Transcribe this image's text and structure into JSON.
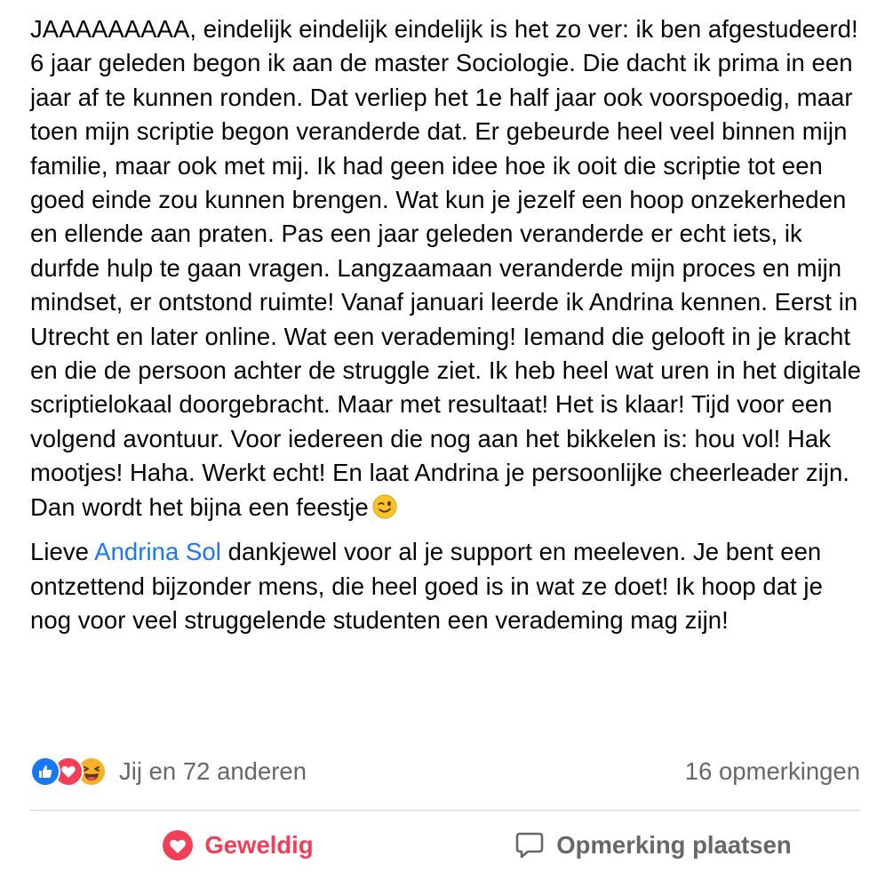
{
  "post": {
    "paragraph1": "JAAAAAAAAA, eindelijk eindelijk eindelijk is het zo ver: ik ben afgestudeerd! 6 jaar geleden begon ik aan de master Sociologie. Die dacht ik prima in een jaar af te kunnen ronden. Dat verliep het 1e half jaar ook voorspoedig, maar toen mijn scriptie begon veranderde dat. Er gebeurde heel veel binnen mijn familie, maar ook met mij. Ik had geen idee hoe ik ooit die scriptie tot een goed einde zou kunnen brengen. Wat kun je jezelf een hoop onzekerheden en ellende aan praten. Pas een jaar geleden veranderde er echt iets, ik durfde hulp te gaan vragen. Langzaamaan veranderde mijn proces en mijn mindset, er ontstond ruimte! Vanaf januari leerde ik Andrina kennen. Eerst in Utrecht en later online. Wat een verademing! Iemand die gelooft in je kracht en die de persoon achter de struggle ziet. Ik heb heel wat uren in het digitale scriptielokaal doorgebracht. Maar met resultaat! Het is klaar! Tijd voor een volgend avontuur. Voor iedereen die nog aan het bikkelen is: hou vol! Hak mootjes! Haha. Werkt echt! En laat Andrina je persoonlijke cheerleader zijn. Dan wordt het bijna een feestje",
    "paragraph2_before": "Lieve ",
    "mention": "Andrina Sol",
    "paragraph2_after": " dankjewel voor al je support en meeleven. Je bent een ontzettend bijzonder mens, die heel goed is in wat ze doet! Ik hoop dat je nog voor veel struggelende studenten een verademing mag zijn!",
    "emoji": "winking-face-icon"
  },
  "stats": {
    "reactions_text": "Jij en 72 anderen",
    "comments_text": "16 opmerkingen",
    "reaction_icons": [
      "like-icon",
      "love-icon",
      "haha-icon"
    ]
  },
  "actions": {
    "like_label": "Geweldig",
    "comment_label": "Opmerking plaatsen"
  },
  "colors": {
    "accent_blue": "#1877f2",
    "love_red": "#f33e58",
    "muted_gray": "#65676b"
  }
}
